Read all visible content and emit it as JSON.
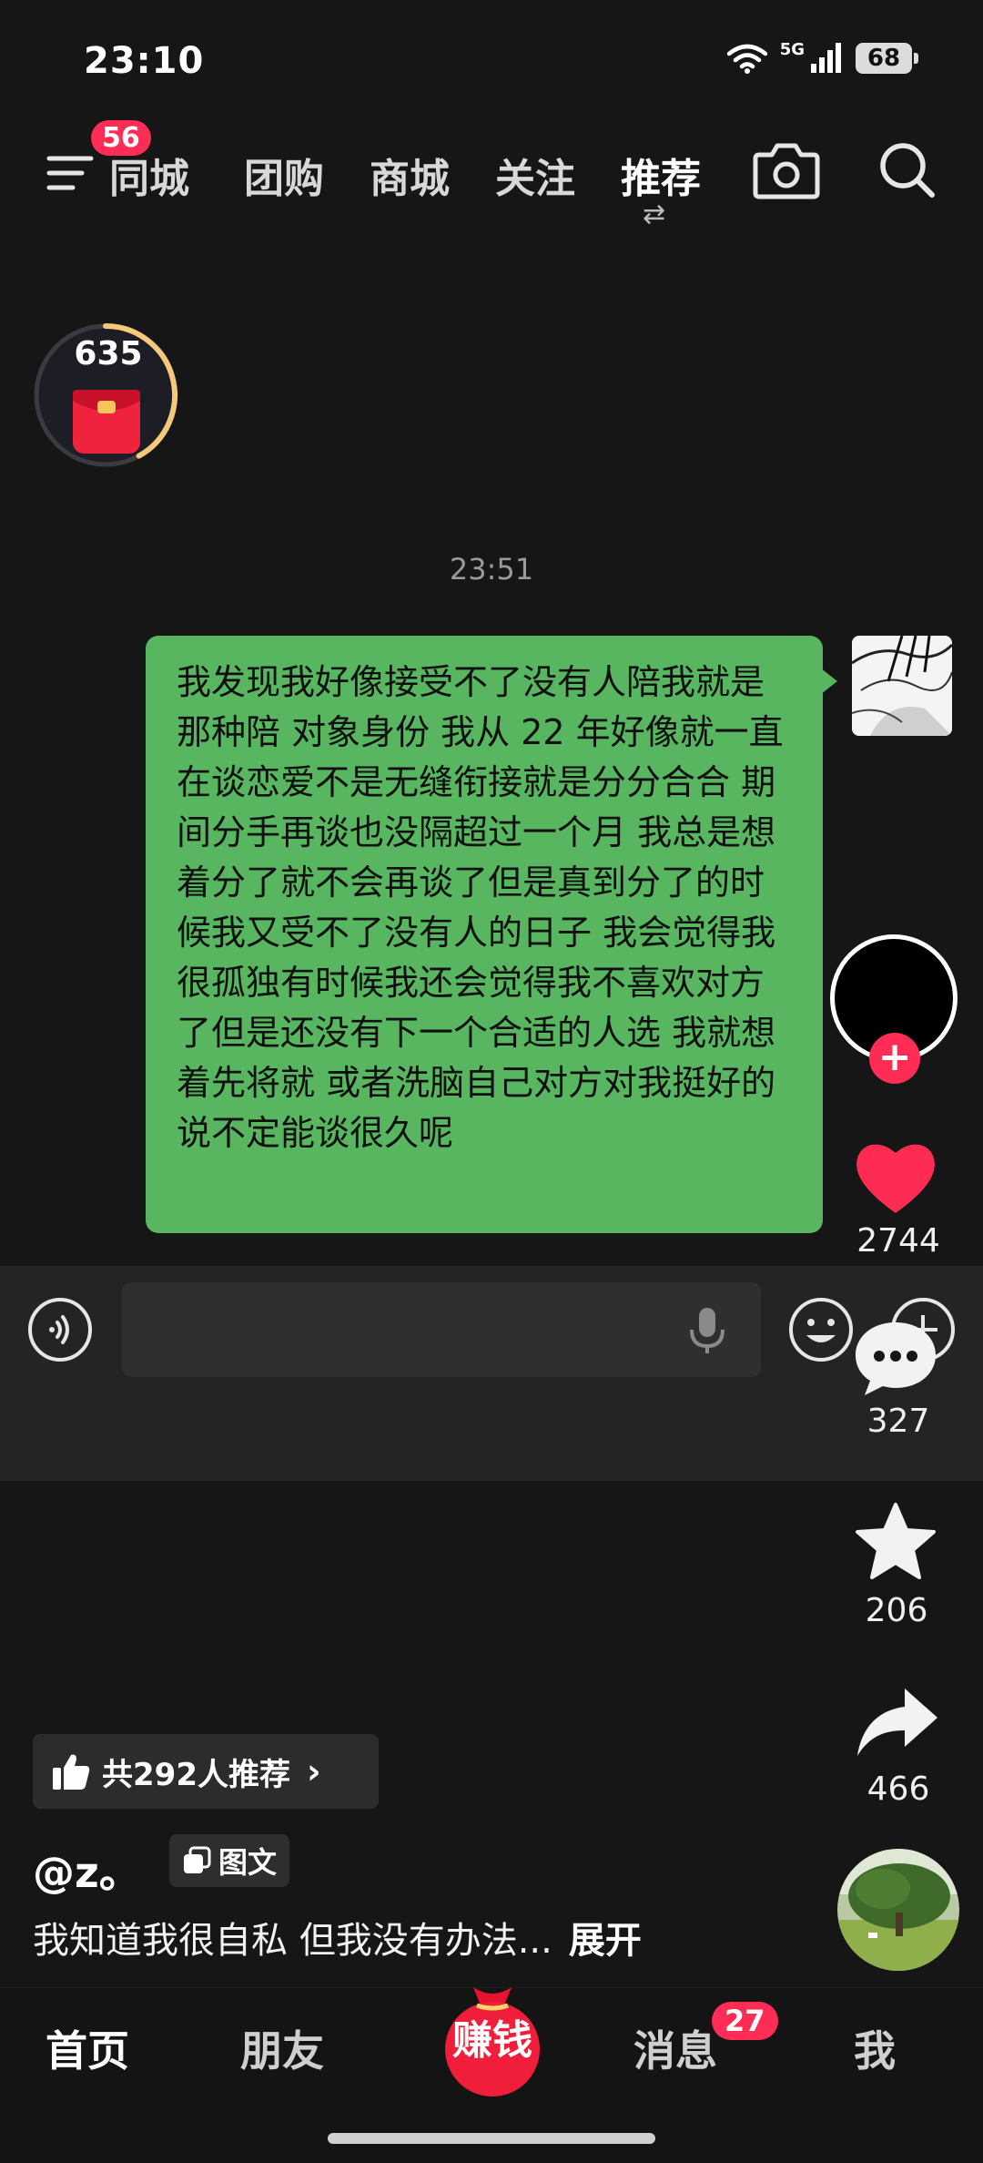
{
  "status_bar": {
    "time": "23:10",
    "network": "5G",
    "battery": "68"
  },
  "top_nav": {
    "menu_badge": "56",
    "tabs": [
      {
        "label": "同城"
      },
      {
        "label": "团购"
      },
      {
        "label": "商城"
      },
      {
        "label": "关注"
      },
      {
        "label": "推荐",
        "active": true
      }
    ]
  },
  "red_packet": {
    "count": "635",
    "progress": 0.42
  },
  "chat": {
    "time": "23:51",
    "message": "我发现我好像接受不了没有人陪我就是那种陪 对象身份 我从 22 年好像就一直在谈恋爱不是无缝衔接就是分分合合 期间分手再谈也没隔超过一个月 我总是想着分了就不会再谈了但是真到分了的时候我又受不了没有人的日子 我会觉得我很孤独有时候我还会觉得我不喜欢对方了但是还没有下一个合适的人选 我就想着先将就 或者洗脑自己对方对我挺好的 说不定能谈很久呢"
  },
  "actions": {
    "likes": "2744",
    "comments": "327",
    "favorites": "206",
    "shares": "466"
  },
  "post": {
    "recommend_text": "共292人推荐",
    "author": "@z。",
    "tag": "图文",
    "caption": "我知道我很自私 但我没有办法...",
    "expand": "展开"
  },
  "bottom_nav": {
    "home": "首页",
    "friends": "朋友",
    "earn": "赚钱",
    "messages": "消息",
    "messages_badge": "27",
    "me": "我"
  },
  "colors": {
    "accent": "#ff2d55",
    "bubble": "#57b65f",
    "background": "#161616"
  }
}
